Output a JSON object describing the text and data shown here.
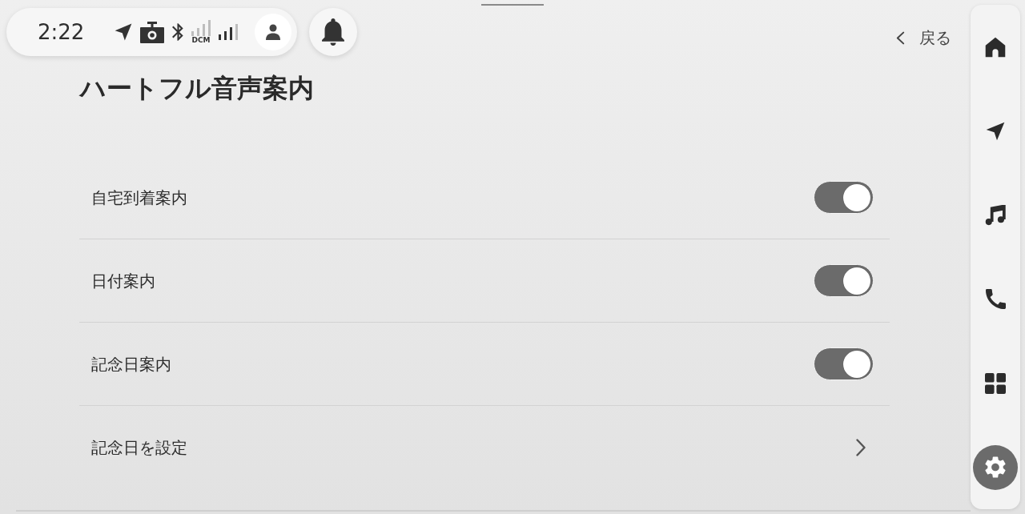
{
  "status_bar": {
    "time": "2:22",
    "network_label": "DCM"
  },
  "back_button": {
    "label": "戻る"
  },
  "title": "ハートフル音声案内",
  "settings": [
    {
      "kind": "toggle",
      "label": "自宅到着案内",
      "on": true
    },
    {
      "kind": "toggle",
      "label": "日付案内",
      "on": true
    },
    {
      "kind": "toggle",
      "label": "記念日案内",
      "on": true
    },
    {
      "kind": "link",
      "label": "記念日を設定"
    }
  ],
  "sidebar": {
    "items": [
      {
        "selected": false
      },
      {
        "selected": false
      },
      {
        "selected": false
      },
      {
        "selected": false
      },
      {
        "selected": false
      },
      {
        "selected": true
      }
    ]
  }
}
